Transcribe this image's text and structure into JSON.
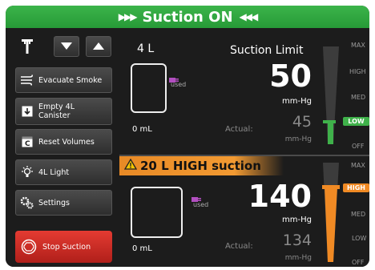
{
  "banner": {
    "title": "Suction ON",
    "color": "#2fa83f"
  },
  "sidebar": {
    "buttons": [
      {
        "label": "Evacuate Smoke",
        "icon": "smoke-wind-icon"
      },
      {
        "label": "Empty 4L Canister",
        "icon": "download-canister-icon"
      },
      {
        "label": "Reset Volumes",
        "icon": "reset-c-icon"
      },
      {
        "label": "4L Light",
        "icon": "light-bulb-icon"
      },
      {
        "label": "Settings",
        "icon": "gears-icon"
      }
    ],
    "stop": {
      "label": "Stop Suction",
      "color": "#d33129"
    }
  },
  "canister_4l": {
    "name": "4 L",
    "used_label": "used",
    "volume": "0 mL",
    "suction_limit_label": "Suction Limit",
    "limit_value": "50",
    "unit": "mm-Hg",
    "actual_label": "Actual:",
    "actual_value": "45",
    "actual_unit": "mm-Hg",
    "level": "LOW",
    "level_color": "#3fb14a"
  },
  "canister_20l": {
    "warning": "20 L HIGH suction",
    "used_label": "used",
    "volume": "0 mL",
    "limit_value": "140",
    "unit": "mm-Hg",
    "actual_label": "Actual:",
    "actual_value": "134",
    "actual_unit": "mm-Hg",
    "level": "HIGH",
    "level_color": "#f08a24"
  },
  "gauge_labels": [
    "MAX",
    "HIGH",
    "MED",
    "LOW",
    "OFF"
  ]
}
